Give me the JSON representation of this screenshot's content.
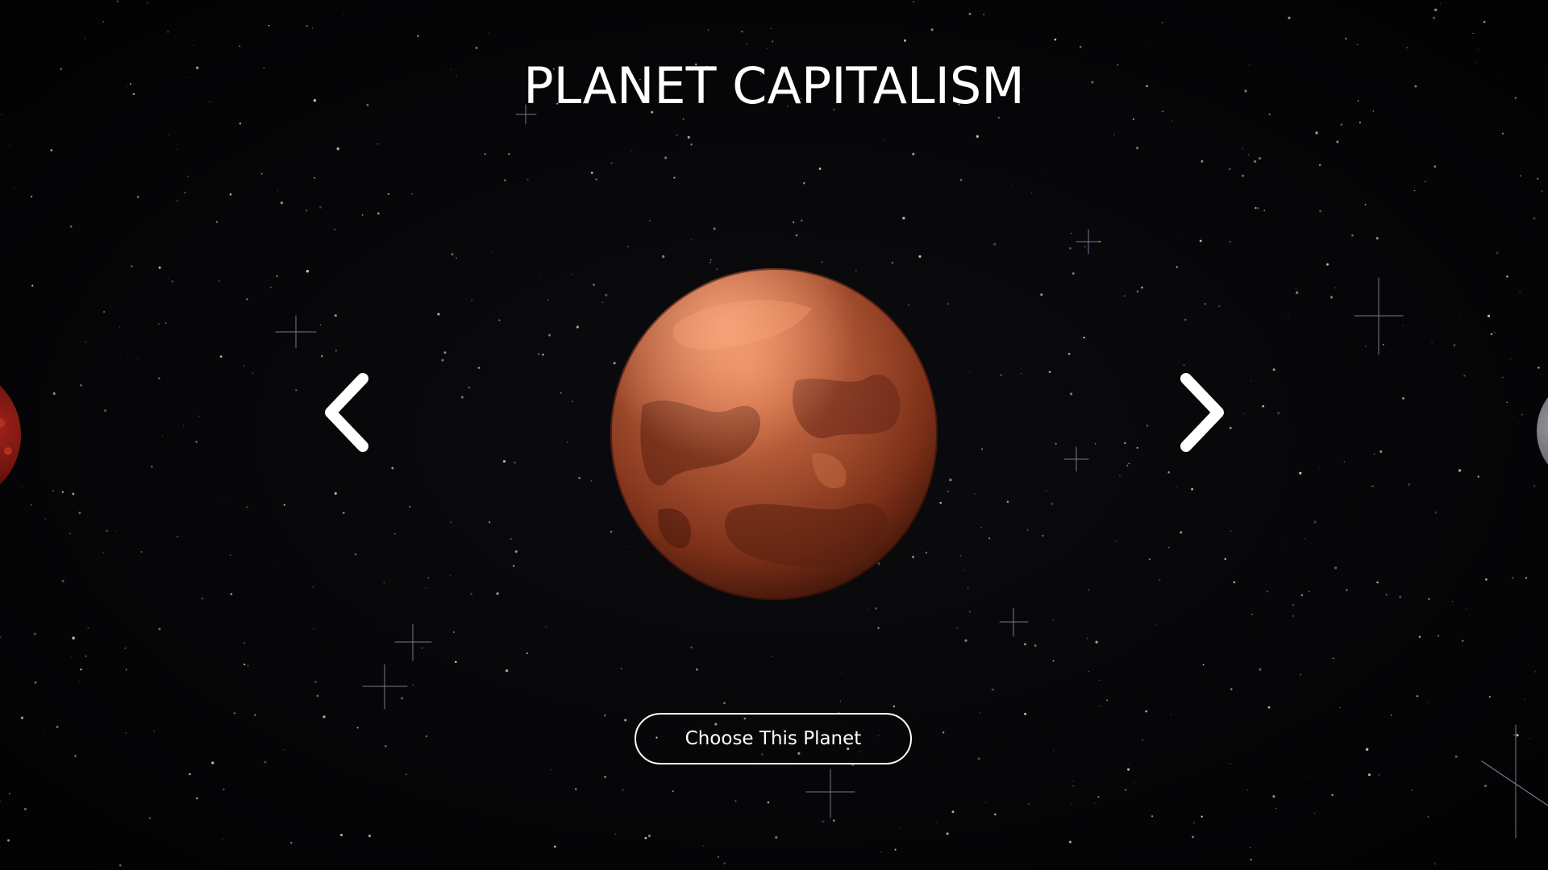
{
  "header": {
    "title": "PLANET CAPITALISM"
  },
  "carousel": {
    "prev_icon": "chevron-left-icon",
    "next_icon": "chevron-right-icon",
    "current_planet": "mars-like red planet"
  },
  "actions": {
    "choose_label": "Choose This Planet"
  },
  "colors": {
    "background": "#050507",
    "text": "#ffffff",
    "planet_primary": "#a8472a",
    "planet_highlight": "#e0724a",
    "planet_shadow": "#4a1a0e"
  }
}
